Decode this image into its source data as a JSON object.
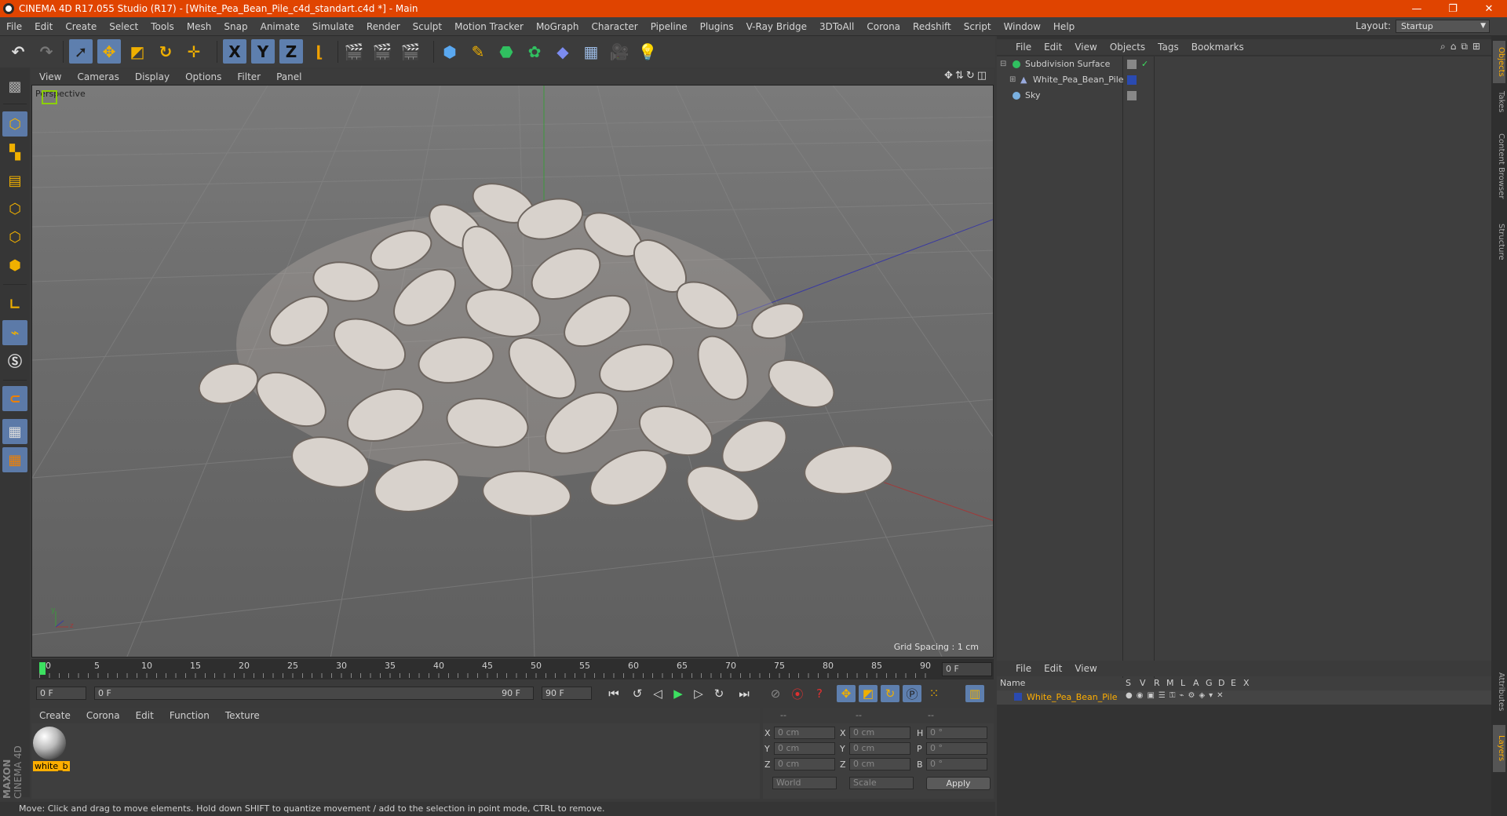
{
  "window": {
    "title": "CINEMA 4D R17.055 Studio (R17) - [White_Pea_Bean_Pile_c4d_standart.c4d *] - Main",
    "minimize": "—",
    "restore": "❐",
    "close": "✕"
  },
  "menu": [
    "File",
    "Edit",
    "Create",
    "Select",
    "Tools",
    "Mesh",
    "Snap",
    "Animate",
    "Simulate",
    "Render",
    "Sculpt",
    "Motion Tracker",
    "MoGraph",
    "Character",
    "Pipeline",
    "Plugins",
    "V-Ray Bridge",
    "3DToAll",
    "Corona",
    "Redshift",
    "Script",
    "Window",
    "Help"
  ],
  "layout": {
    "label": "Layout:",
    "value": "Startup"
  },
  "toolbar": {
    "x": "X",
    "y": "Y",
    "z": "Z"
  },
  "viewport": {
    "menu": [
      "View",
      "Cameras",
      "Display",
      "Options",
      "Filter",
      "Panel"
    ],
    "label": "Perspective",
    "grid_spacing": "Grid Spacing : 1 cm",
    "axis_y": "y",
    "axis_z": "z"
  },
  "timeline": {
    "ticks": [
      "0",
      "5",
      "10",
      "15",
      "20",
      "25",
      "30",
      "35",
      "40",
      "45",
      "50",
      "55",
      "60",
      "65",
      "70",
      "75",
      "80",
      "85",
      "90"
    ],
    "current": "0 F",
    "start": "0 F",
    "range_start": "0 F",
    "range_end": "90 F",
    "end": "90 F"
  },
  "materials": {
    "menu": [
      "Create",
      "Corona",
      "Edit",
      "Function",
      "Texture"
    ],
    "items": [
      {
        "name": "white_b"
      }
    ]
  },
  "coordinates": {
    "head": [
      "--",
      "--",
      "--"
    ],
    "rows": [
      {
        "a": "X",
        "av": "0 cm",
        "b": "X",
        "bv": "0 cm",
        "c": "H",
        "cv": "0 °"
      },
      {
        "a": "Y",
        "av": "0 cm",
        "b": "Y",
        "bv": "0 cm",
        "c": "P",
        "cv": "0 °"
      },
      {
        "a": "Z",
        "av": "0 cm",
        "b": "Z",
        "bv": "0 cm",
        "c": "B",
        "cv": "0 °"
      }
    ],
    "space": "World",
    "mode": "Scale",
    "apply": "Apply"
  },
  "status": "Move: Click and drag to move elements. Hold down SHIFT to quantize movement / add to the selection in point mode, CTRL to remove.",
  "logo": {
    "line1": "MAXON",
    "line2": "CINEMA 4D"
  },
  "objects": {
    "menu": [
      "File",
      "Edit",
      "View",
      "Objects",
      "Tags",
      "Bookmarks"
    ],
    "rows": [
      {
        "name": "Subdivision Surface"
      },
      {
        "name": "White_Pea_Bean_Pile"
      },
      {
        "name": "Sky"
      }
    ]
  },
  "layers": {
    "menu": [
      "File",
      "Edit",
      "View"
    ],
    "cols": [
      "S",
      "V",
      "R",
      "M",
      "L",
      "A",
      "G",
      "D",
      "E",
      "X"
    ],
    "name_header": "Name",
    "rows": [
      {
        "name": "White_Pea_Bean_Pile"
      }
    ]
  },
  "side_tabs": [
    "Objects",
    "Takes",
    "Content Browser",
    "Structure",
    "Attributes",
    "Layers"
  ],
  "colors": {
    "titlebar": "#e04400",
    "selected": "#5e7fae",
    "layer_name": "#ffae00"
  }
}
